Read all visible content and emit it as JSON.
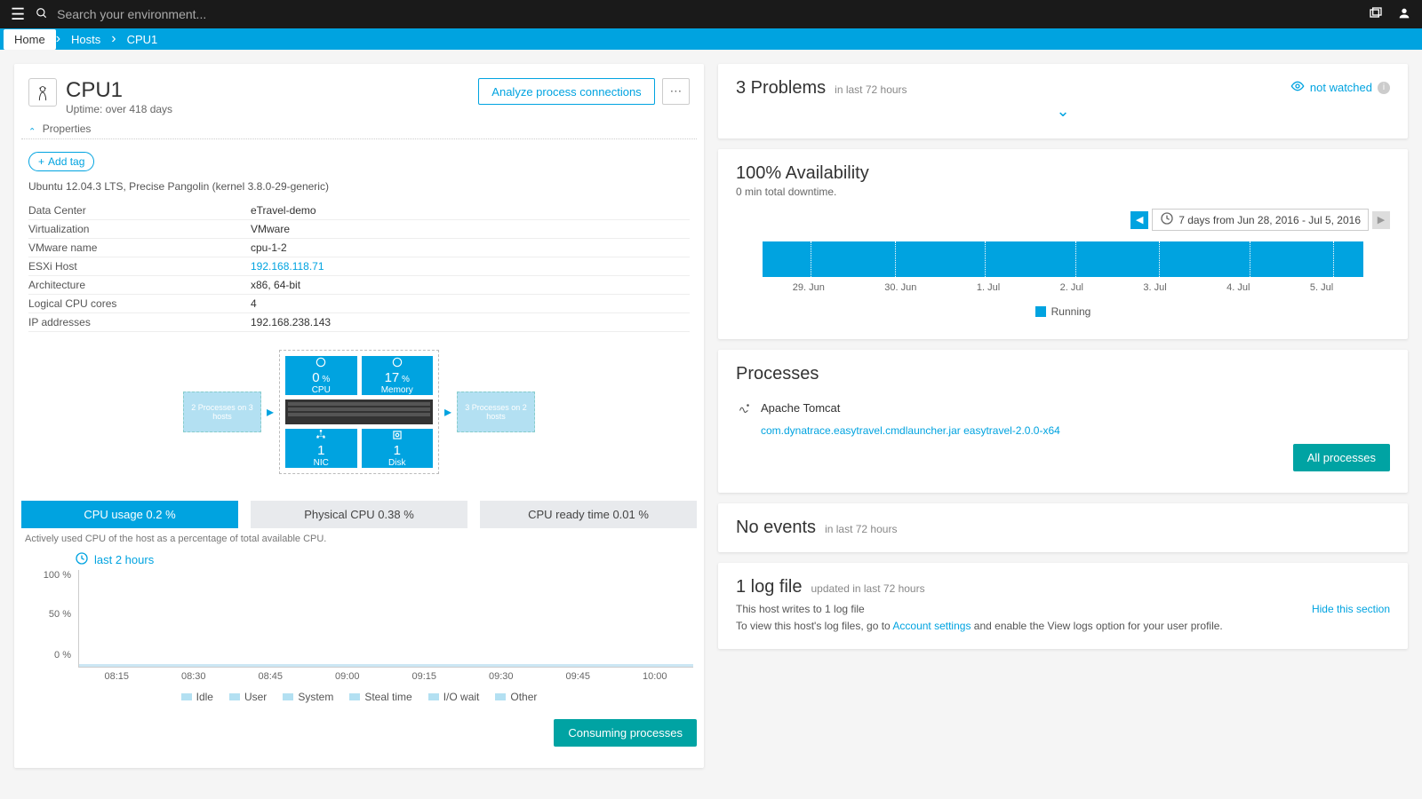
{
  "search": {
    "placeholder": "Search your environment..."
  },
  "breadcrumb": [
    "Home",
    "Hosts",
    "CPU1"
  ],
  "host": {
    "title": "CPU1",
    "uptime": "Uptime: over 418 days",
    "analyze_btn": "Analyze process connections",
    "properties_label": "Properties",
    "add_tag": "Add tag",
    "os": "Ubuntu 12.04.3 LTS, Precise Pangolin (kernel 3.8.0-29-generic)",
    "props": [
      {
        "k": "Data Center",
        "v": "eTravel-demo"
      },
      {
        "k": "Virtualization",
        "v": "VMware"
      },
      {
        "k": "VMware name",
        "v": "cpu-1-2"
      },
      {
        "k": "ESXi Host",
        "v": "192.168.118.71",
        "link": true
      },
      {
        "k": "Architecture",
        "v": "x86, 64-bit"
      },
      {
        "k": "Logical CPU cores",
        "v": "4"
      },
      {
        "k": "IP addresses",
        "v": "192.168.238.143"
      }
    ]
  },
  "topology": {
    "left": "2 Processes on 3 hosts",
    "right": "3 Processes on 2 hosts",
    "cpu": {
      "val": "0",
      "unit": "%",
      "label": "CPU"
    },
    "mem": {
      "val": "17",
      "unit": "%",
      "label": "Memory"
    },
    "nic": {
      "val": "1",
      "label": "NIC"
    },
    "disk": {
      "val": "1",
      "label": "Disk"
    }
  },
  "tabs": [
    {
      "label": "CPU usage 0.2 %",
      "active": true
    },
    {
      "label": "Physical CPU 0.38 %"
    },
    {
      "label": "CPU ready time 0.01 %"
    }
  ],
  "tab_desc": "Actively used CPU of the host as a percentage of total available CPU.",
  "chart_controls": {
    "range": "last 2 hours"
  },
  "chart_data": {
    "type": "area",
    "ylabels": [
      "100 %",
      "50 %",
      "0 %"
    ],
    "ylim": [
      0,
      100
    ],
    "x": [
      "08:15",
      "08:30",
      "08:45",
      "09:00",
      "09:15",
      "09:30",
      "09:45",
      "10:00"
    ],
    "series": [
      {
        "name": "Idle",
        "values": [
          1,
          1,
          1,
          1,
          1,
          1,
          1,
          1
        ]
      },
      {
        "name": "User",
        "values": [
          0,
          0,
          0,
          0,
          0,
          0,
          0,
          0
        ]
      },
      {
        "name": "System",
        "values": [
          0,
          0,
          0,
          0,
          0,
          0,
          0,
          0
        ]
      },
      {
        "name": "Steal time",
        "values": [
          0,
          0,
          0,
          0,
          0,
          0,
          0,
          0
        ]
      },
      {
        "name": "I/O wait",
        "values": [
          0,
          0,
          0,
          0,
          0,
          0,
          0,
          0
        ]
      },
      {
        "name": "Other",
        "values": [
          0,
          0,
          0,
          0,
          0,
          0,
          0,
          0
        ]
      }
    ],
    "legend": [
      "Idle",
      "User",
      "System",
      "Steal time",
      "I/O wait",
      "Other"
    ]
  },
  "consuming_btn": "Consuming processes",
  "problems": {
    "title": "3 Problems",
    "sub": "in last 72 hours",
    "watched": "not watched"
  },
  "availability": {
    "title": "100% Availability",
    "sub": "0 min total downtime.",
    "range": "7 days from Jun 28, 2016 - Jul 5, 2016",
    "labels": [
      "29. Jun",
      "30. Jun",
      "1. Jul",
      "2. Jul",
      "3. Jul",
      "4. Jul",
      "5. Jul"
    ],
    "legend": "Running"
  },
  "processes": {
    "title": "Processes",
    "name": "Apache Tomcat",
    "detail": "com.dynatrace.easytravel.cmdlauncher.jar easytravel-2.0.0-x64",
    "all_btn": "All processes"
  },
  "events": {
    "title": "No events",
    "sub": "in last 72 hours"
  },
  "log": {
    "title": "1 log file",
    "sub": "updated in last 72 hours",
    "line1": "This host writes to 1 log file",
    "line2a": "To view this host's log files, go to ",
    "line2b": "Account settings",
    "line2c": " and enable the View logs option for your user profile.",
    "hide": "Hide this section"
  }
}
